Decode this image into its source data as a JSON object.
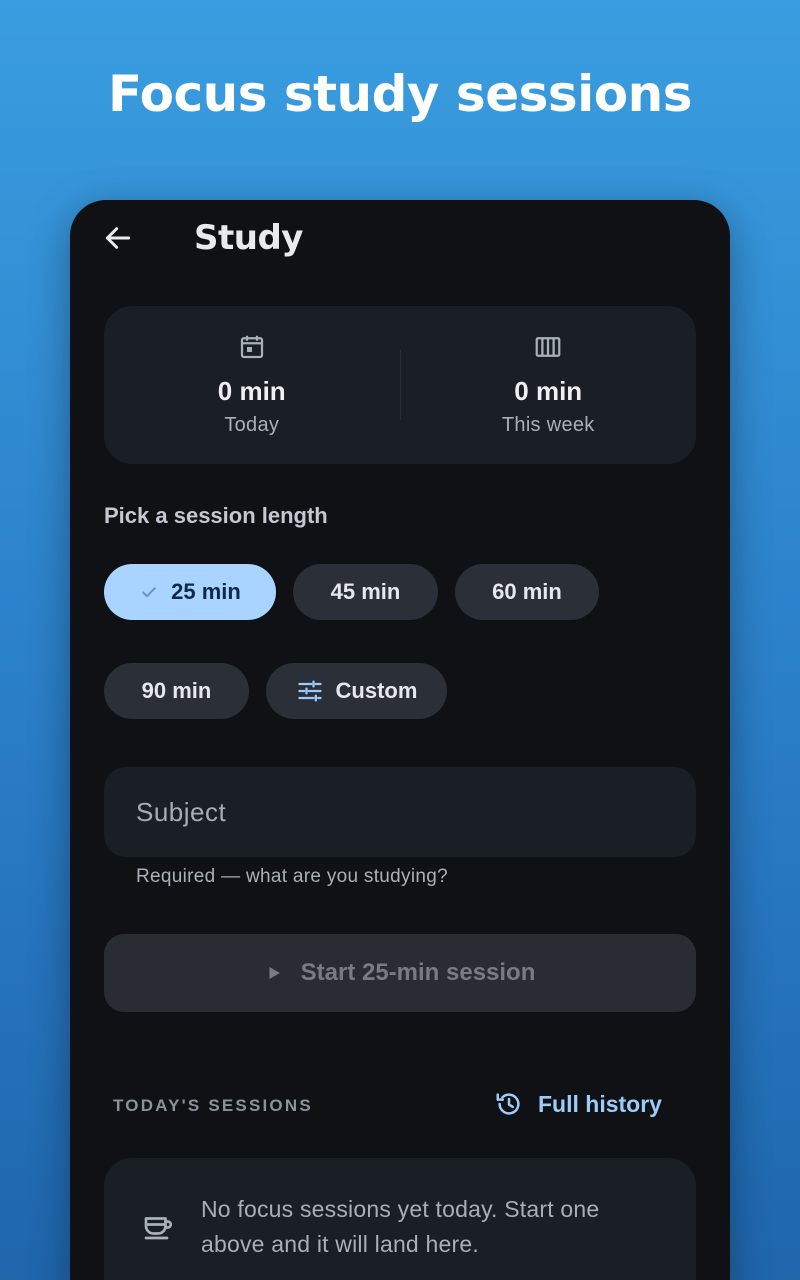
{
  "promo": {
    "title": "Focus study sessions"
  },
  "appbar": {
    "title": "Study",
    "back_icon": "arrow-left-icon"
  },
  "stats": [
    {
      "icon": "calendar-icon",
      "value": "0 min",
      "label": "Today"
    },
    {
      "icon": "week-grid-icon",
      "value": "0 min",
      "label": "This week"
    }
  ],
  "session_picker": {
    "label": "Pick a session length",
    "options": [
      {
        "label": "25 min",
        "selected": true
      },
      {
        "label": "45 min",
        "selected": false
      },
      {
        "label": "60 min",
        "selected": false
      },
      {
        "label": "90 min",
        "selected": false
      },
      {
        "label": "Custom",
        "icon": "tune-icon",
        "selected": false
      }
    ]
  },
  "subject": {
    "placeholder": "Subject",
    "value": "",
    "helper": "Required — what are you studying?"
  },
  "start_button": {
    "label": "Start 25-min session",
    "icon": "play-icon",
    "enabled": false
  },
  "todays_sessions": {
    "header": "TODAY'S SESSIONS",
    "history_label": "Full history",
    "history_icon": "history-icon",
    "empty_icon": "cup-icon",
    "empty_text": "No focus sessions yet today. Start one above and it will land here."
  },
  "colors": {
    "accent": "#a8d4ff",
    "link": "#9cccf8",
    "surface": "#1a1e25",
    "background": "#0f1115"
  }
}
